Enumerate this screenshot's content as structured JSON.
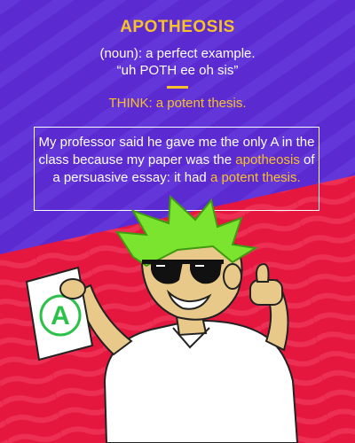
{
  "word": "APOTHEOSIS",
  "definition": "(noun): a perfect example.",
  "pronunciation": "“uh POTH ee oh sis”",
  "mnemonic": "THINK: a potent thesis.",
  "sentence": {
    "part1": "My professor said he gave me the only A in the class because my paper was the ",
    "highlight1": "apotheosis",
    "part2": " of a persuasive essay: it had ",
    "highlight2": "a potent thesis."
  },
  "paper_grade": "A",
  "colors": {
    "purple": "#5b2ad0",
    "red": "#e5173f",
    "gold": "#f7c12a",
    "hair_green": "#7be42e",
    "skin": "#e9c98a"
  }
}
